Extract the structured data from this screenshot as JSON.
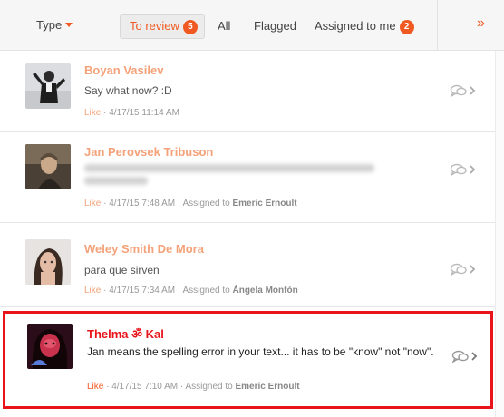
{
  "toolbar": {
    "type_label": "Type",
    "tabs": [
      {
        "label": "To review",
        "badge": "5",
        "active": true
      },
      {
        "label": "All"
      },
      {
        "label": "Flagged"
      },
      {
        "label": "Assigned to me",
        "badge": "2"
      }
    ],
    "expand_icon": "double-chevron-right-icon"
  },
  "items": [
    {
      "name": "Boyan Vasilev",
      "message": "Say what now? :D",
      "like": "Like",
      "timestamp": "4/17/15 11:14 AM",
      "assigned_prefix": "",
      "assignee": ""
    },
    {
      "name": "Jan Perovsek Tribuson",
      "message": "",
      "like": "Like",
      "timestamp": "4/17/15 7:48 AM",
      "assigned_prefix": "Assigned to",
      "assignee": "Emeric Ernoult"
    },
    {
      "name": "Weley Smith De Mora",
      "message": "para que sirven",
      "like": "Like",
      "timestamp": "4/17/15 7:34 AM",
      "assigned_prefix": "Assigned to",
      "assignee": "Ángela Monfón"
    },
    {
      "name": "Thelma ॐ Kal",
      "message": "Jan means the spelling error in your text... it has to be \"know\" not \"now\".",
      "like": "Like",
      "timestamp": "4/17/15 7:10 AM",
      "assigned_prefix": "Assigned to",
      "assignee": "Emeric Ernoult",
      "selected": true
    }
  ],
  "colors": {
    "accent": "#f05a22",
    "name": "#f4a27a",
    "selected_border": "#e8141a"
  }
}
